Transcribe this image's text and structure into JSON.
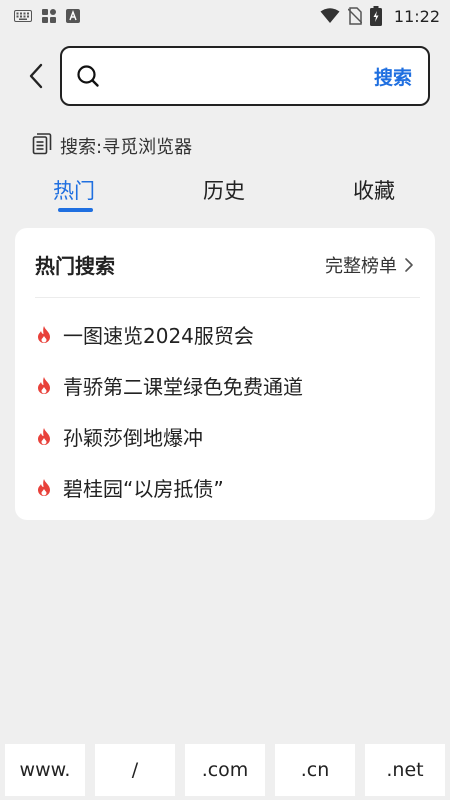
{
  "status_bar": {
    "time": "11:22",
    "left_icons": [
      "keyboard-icon",
      "apps-icon",
      "font-icon"
    ],
    "right_icons": [
      "wifi-icon",
      "no-sim-icon",
      "battery-charging-icon"
    ]
  },
  "search": {
    "placeholder": "",
    "value": "",
    "submit_label": "搜索"
  },
  "hint": {
    "text": "搜索:寻觅浏览器",
    "icon": "document-icon"
  },
  "tabs": [
    {
      "label": "热门",
      "active": true
    },
    {
      "label": "历史",
      "active": false
    },
    {
      "label": "收藏",
      "active": false
    }
  ],
  "hot_card": {
    "title": "热门搜索",
    "link_label": "完整榜单",
    "items": [
      {
        "text": "一图速览2024服贸会"
      },
      {
        "text": "青骄第二课堂绿色免费通道"
      },
      {
        "text": "孙颖莎倒地爆冲"
      },
      {
        "text": "碧桂园“以房抵债”"
      }
    ]
  },
  "shortcuts": [
    "www.",
    "/",
    ".com",
    ".cn",
    ".net"
  ],
  "colors": {
    "accent": "#1f6fe0",
    "flame": "#e8413a",
    "background": "#efefef"
  }
}
